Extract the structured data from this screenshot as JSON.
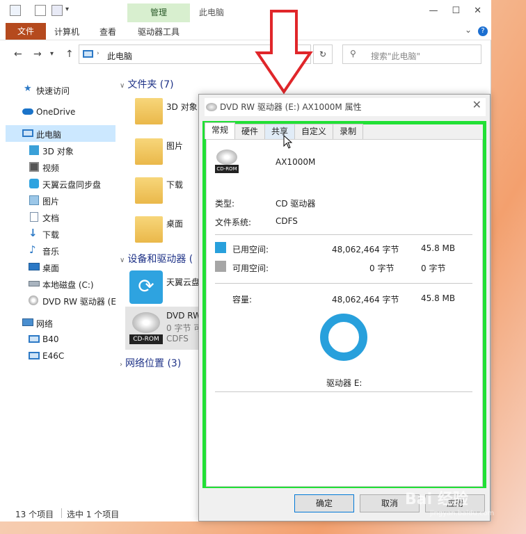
{
  "window": {
    "title": "此电脑",
    "manage_tab": "管理"
  },
  "ribbon": {
    "tabs": [
      "文件",
      "计算机",
      "查看",
      "驱动器工具"
    ]
  },
  "address": {
    "path": "此电脑",
    "search_placeholder": "搜索\"此电脑\""
  },
  "sidebar": {
    "items": [
      {
        "label": "快速访问",
        "icon": "star-icon"
      },
      {
        "label": "OneDrive",
        "icon": "cloud-icon"
      },
      {
        "label": "此电脑",
        "icon": "computer-icon"
      },
      {
        "label": "3D 对象",
        "icon": "cube-icon"
      },
      {
        "label": "视频",
        "icon": "video-icon"
      },
      {
        "label": "天翼云盘同步盘",
        "icon": "sync-icon"
      },
      {
        "label": "图片",
        "icon": "picture-icon"
      },
      {
        "label": "文档",
        "icon": "document-icon"
      },
      {
        "label": "下载",
        "icon": "download-icon"
      },
      {
        "label": "音乐",
        "icon": "music-icon"
      },
      {
        "label": "桌面",
        "icon": "desktop-icon"
      },
      {
        "label": "本地磁盘 (C:)",
        "icon": "disk-icon"
      },
      {
        "label": "DVD RW 驱动器 (E",
        "icon": "dvd-icon"
      },
      {
        "label": "网络",
        "icon": "network-icon"
      },
      {
        "label": "B40",
        "icon": "computer-icon"
      },
      {
        "label": "E46C",
        "icon": "computer-icon"
      }
    ]
  },
  "content": {
    "folders_header": "文件夹 (7)",
    "folders": [
      "3D 对象",
      "图片",
      "下载",
      "桌面"
    ],
    "devices_header": "设备和驱动器 (",
    "device1": "天翼云盘",
    "dvd_name": "DVD RW",
    "dvd_free": "0 字节 可",
    "dvd_fs": "CDFS",
    "cdrom_label": "CD-ROM",
    "network_header": "网络位置 (3)"
  },
  "status": {
    "count": "13 个项目",
    "selected": "选中 1 个项目"
  },
  "dialog": {
    "title": "DVD RW 驱动器 (E:) AX1000M 属性",
    "tabs": [
      "常规",
      "硬件",
      "共享",
      "自定义",
      "录制"
    ],
    "label": "AX1000M",
    "cdrom_badge": "CD-ROM",
    "type_label": "类型:",
    "type_value": "CD 驱动器",
    "fs_label": "文件系统:",
    "fs_value": "CDFS",
    "used_label": "已用空间:",
    "used_bytes": "48,062,464 字节",
    "used_mb": "45.8 MB",
    "free_label": "可用空间:",
    "free_bytes": "0 字节",
    "free_mb": "0 字节",
    "capacity_label": "容量:",
    "capacity_bytes": "48,062,464 字节",
    "capacity_mb": "45.8 MB",
    "drive_label": "驱动器 E:",
    "ok": "确定",
    "cancel": "取消",
    "apply": "应用",
    "used_color": "#28a0dc",
    "free_color": "#a6a6a6"
  },
  "watermark": {
    "brand": "Bai 经验",
    "url": "jingyan.baidu.com"
  }
}
